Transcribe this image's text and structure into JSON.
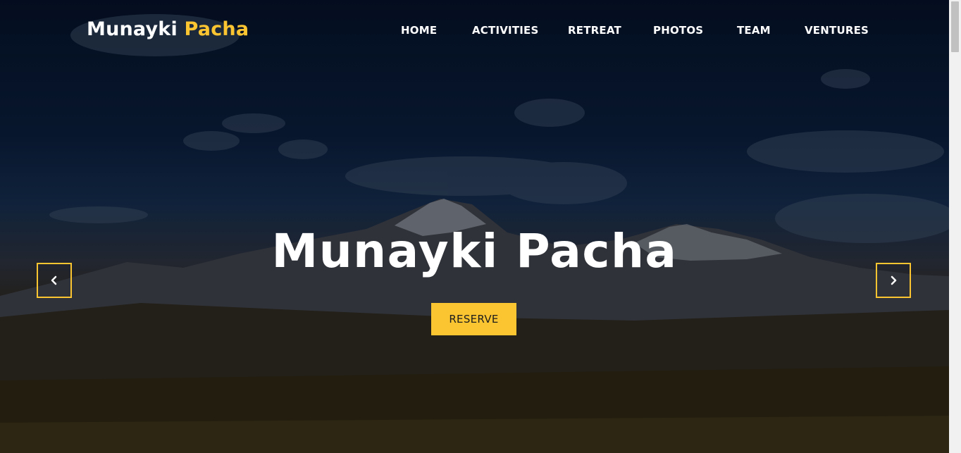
{
  "brand": {
    "name_main": "Munayki",
    "name_accent": "Pacha"
  },
  "nav": {
    "items": [
      {
        "label": "HOME"
      },
      {
        "label": "ACTIVITIES"
      },
      {
        "label": "RETREAT"
      },
      {
        "label": "PHOTOS"
      },
      {
        "label": "TEAM"
      },
      {
        "label": "VENTURES"
      }
    ]
  },
  "hero": {
    "headline": "Munayki Pacha",
    "cta_label": "RESERVE",
    "prev_icon": "chevron-left-icon",
    "next_icon": "chevron-right-icon"
  },
  "colors": {
    "accent": "#fbc531",
    "text": "#ffffff",
    "cta_text": "#1c1c1c"
  }
}
